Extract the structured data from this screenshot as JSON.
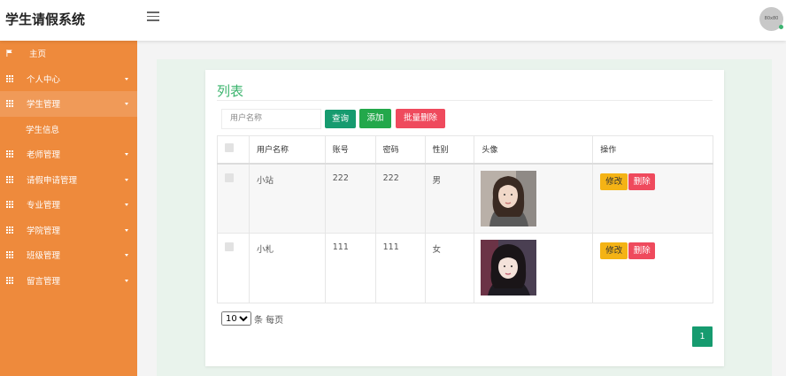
{
  "header": {
    "brand": "学生请假系统",
    "avatar_text": "80x80"
  },
  "sidebar": {
    "items": [
      {
        "label": "主页",
        "icon": "flag-icon",
        "caret": false
      },
      {
        "label": "个人中心",
        "icon": "grid-icon",
        "caret": true
      },
      {
        "label": "学生管理",
        "icon": "grid-icon",
        "caret": true,
        "active": true
      },
      {
        "label": "学生信息",
        "submenu": true
      },
      {
        "label": "老师管理",
        "icon": "grid-icon",
        "caret": true
      },
      {
        "label": "请假申请管理",
        "icon": "grid-icon",
        "caret": true
      },
      {
        "label": "专业管理",
        "icon": "grid-icon",
        "caret": true
      },
      {
        "label": "学院管理",
        "icon": "grid-icon",
        "caret": true
      },
      {
        "label": "班级管理",
        "icon": "grid-icon",
        "caret": true
      },
      {
        "label": "留言管理",
        "icon": "grid-icon",
        "caret": true
      }
    ]
  },
  "main": {
    "title": "列表",
    "search": {
      "placeholder": "用户名称"
    },
    "buttons": {
      "query": "查询",
      "add": "添加",
      "batch_delete": "批量删除"
    },
    "table": {
      "columns": [
        "",
        "用户名称",
        "账号",
        "密码",
        "性别",
        "头像",
        "操作"
      ],
      "rows": [
        {
          "name": "小站",
          "account": "222",
          "password": "222",
          "gender": "男"
        },
        {
          "name": "小札",
          "account": "111",
          "password": "111",
          "gender": "女"
        }
      ],
      "actions": {
        "edit": "修改",
        "delete": "删除"
      }
    },
    "pagination": {
      "page_size": "10",
      "page_size_suffix": "条 每页",
      "current_page": "1"
    }
  },
  "colors": {
    "sidebar": "#ee8a3c",
    "accent_green": "#3cb46e",
    "query_button": "#169b6f",
    "add_button": "#23a84b",
    "delete_button": "#ef4a5d",
    "edit_button": "#f4b315"
  }
}
